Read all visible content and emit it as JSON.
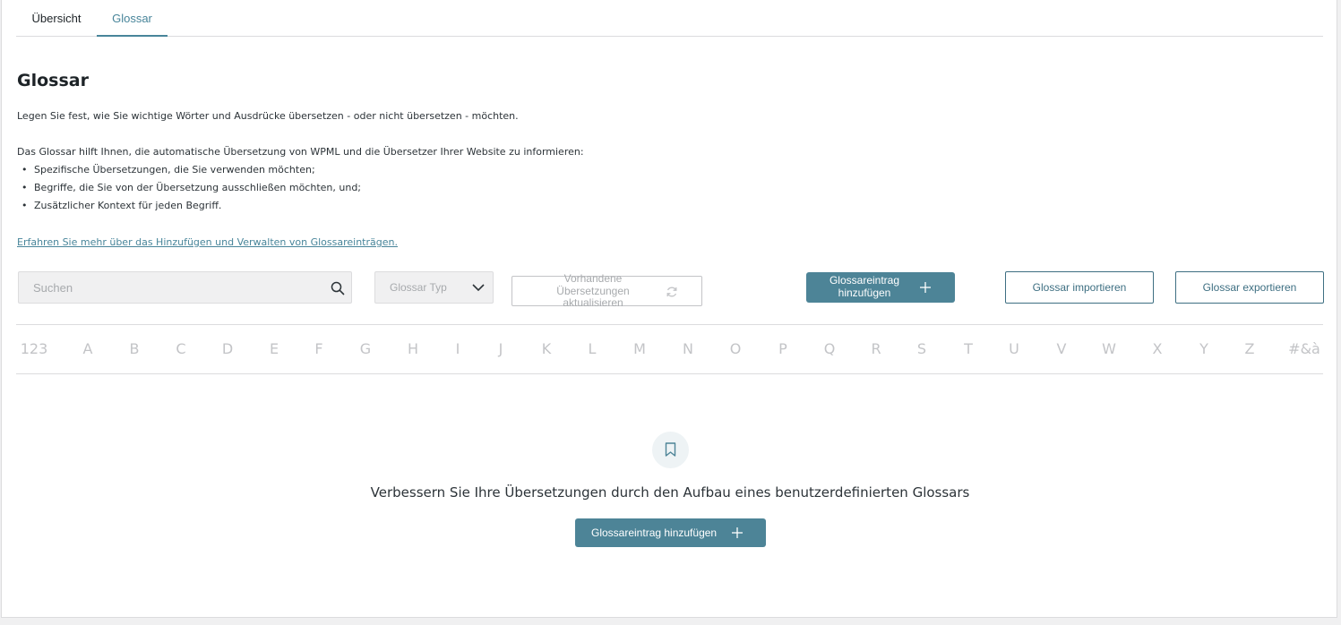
{
  "tabs": {
    "overview": "Übersicht",
    "glossary": "Glossar"
  },
  "header": {
    "title": "Glossar",
    "intro": "Legen Sie fest, wie Sie wichtige Wörter und Ausdrücke übersetzen - oder nicht übersetzen - möchten.",
    "explain": "Das Glossar hilft Ihnen, die automatische Übersetzung von WPML und die Übersetzer Ihrer Website zu informieren:",
    "bullets": [
      "Spezifische Übersetzungen, die Sie verwenden möchten;",
      "Begriffe, die Sie von der Übersetzung ausschließen möchten, und;",
      "Zusätzlicher Kontext für jeden Begriff."
    ],
    "learn_more": "Erfahren Sie mehr über das Hinzufügen und Verwalten von Glossareinträgen."
  },
  "toolbar": {
    "search_placeholder": "Suchen",
    "type_label": "Glossar Typ",
    "refresh_label": "Vorhandene Übersetzungen aktualisieren",
    "add_label": "Glossareintrag hinzufügen",
    "import_label": "Glossar importieren",
    "export_label": "Glossar exportieren"
  },
  "alphabet": [
    "123",
    "A",
    "B",
    "C",
    "D",
    "E",
    "F",
    "G",
    "H",
    "I",
    "J",
    "K",
    "L",
    "M",
    "N",
    "O",
    "P",
    "Q",
    "R",
    "S",
    "T",
    "U",
    "V",
    "W",
    "X",
    "Y",
    "Z",
    "#&à"
  ],
  "empty": {
    "message": "Verbessern Sie Ihre Übersetzungen durch den Aufbau eines benutzerdefinierten Glossars",
    "add_label": "Glossareintrag hinzufügen"
  },
  "icons": {
    "search": "search-icon",
    "chevron": "chevron-down-icon",
    "refresh": "refresh-icon",
    "plus": "plus-icon",
    "bookmark": "bookmark-icon"
  },
  "colors": {
    "accent": "#48859a",
    "primary_button": "#4d8497",
    "outline_button": "#3e6f82"
  }
}
